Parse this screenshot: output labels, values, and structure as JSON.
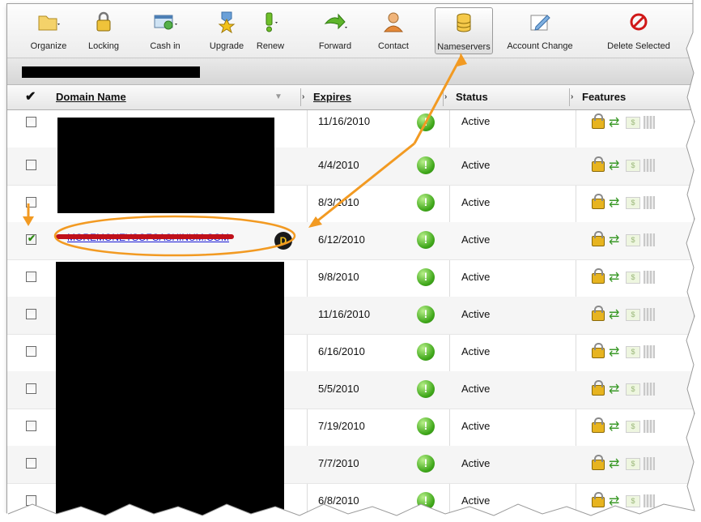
{
  "toolbar": {
    "buttons": [
      {
        "label": "Organize",
        "icon": "folder-icon"
      },
      {
        "label": "Locking",
        "icon": "lock-icon"
      },
      {
        "label": "Cash in",
        "icon": "cash-in-icon"
      },
      {
        "label": "Upgrade",
        "icon": "medal-icon"
      },
      {
        "label": "Renew",
        "icon": "renew-icon"
      },
      {
        "label": "Forward",
        "icon": "forward-arrow-icon"
      },
      {
        "label": "Contact",
        "icon": "contact-person-icon"
      },
      {
        "label": "Nameservers",
        "icon": "database-icon"
      },
      {
        "label": "Account Change",
        "icon": "account-change-icon"
      },
      {
        "label": "Delete Selected",
        "icon": "delete-icon"
      }
    ]
  },
  "table": {
    "headers": {
      "check": "✔",
      "domain": "Domain Name",
      "expires": "Expires",
      "status": "Status",
      "features": "Features"
    },
    "rows": [
      {
        "expires": "11/16/2010",
        "status": "Active",
        "checked": false
      },
      {
        "expires": "4/4/2010",
        "status": "Active",
        "checked": false
      },
      {
        "expires": "8/3/2010",
        "status": "Active",
        "checked": false
      },
      {
        "expires": "6/12/2010",
        "status": "Active",
        "checked": true,
        "domain": "MOREMONEYSOFCASHINUM.COM",
        "badge": "D"
      },
      {
        "expires": "9/8/2010",
        "status": "Active",
        "checked": false
      },
      {
        "expires": "11/16/2010",
        "status": "Active",
        "checked": false
      },
      {
        "expires": "6/16/2010",
        "status": "Active",
        "checked": false
      },
      {
        "expires": "5/5/2010",
        "status": "Active",
        "checked": false
      },
      {
        "expires": "7/19/2010",
        "status": "Active",
        "checked": false
      },
      {
        "expires": "7/7/2010",
        "status": "Active",
        "checked": false
      },
      {
        "expires": "6/8/2010",
        "status": "Active",
        "checked": false
      }
    ]
  },
  "colors": {
    "annotation_orange": "#f29a22",
    "accent_green": "#3fa71a",
    "link_blue": "#1a1ad6",
    "scribble_red": "#c0101a"
  }
}
